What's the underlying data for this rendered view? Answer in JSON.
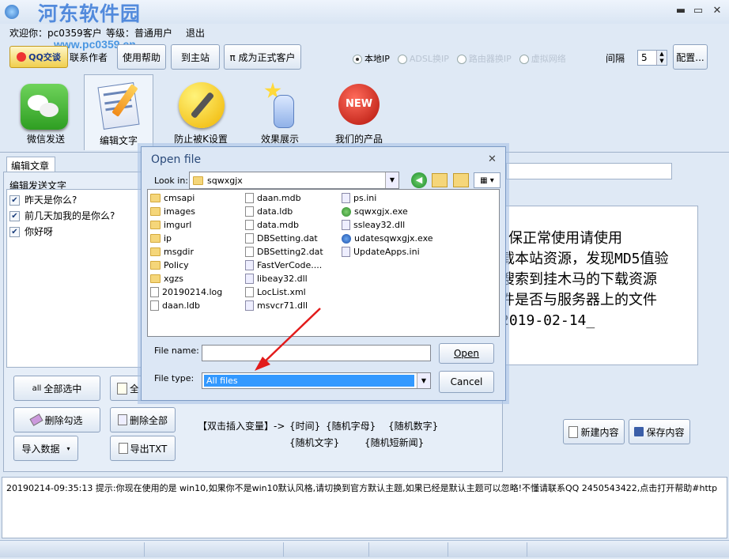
{
  "app": {
    "title_watermark": "河东软件园",
    "url_watermark": "www.pc0359.cn",
    "welcome": "欢迎你：pc0359客户",
    "level": "等级：普通用户",
    "logout": "退出"
  },
  "toolbar": {
    "qq": "QQ交谈",
    "contact": "联系作者",
    "help": "使用帮助",
    "site": "到主站",
    "upgrade": "π 成为正式客户",
    "radios": [
      {
        "label": "本地IP",
        "selected": true
      },
      {
        "label": "ADSL换IP",
        "selected": false
      },
      {
        "label": "路由器换IP",
        "selected": false
      },
      {
        "label": "虚拟网络",
        "selected": false
      }
    ],
    "interval_label": "间隔",
    "interval_value": "5",
    "config": "配置..."
  },
  "tabs": [
    {
      "label": "微信发送",
      "icon": "wechat-icon"
    },
    {
      "label": "编辑文字",
      "icon": "edit-icon"
    },
    {
      "label": "防止被K设置",
      "icon": "wrench-icon"
    },
    {
      "label": "效果展示",
      "icon": "pointer-icon"
    },
    {
      "label": "我们的产品",
      "icon": "new-badge-icon"
    }
  ],
  "editor": {
    "subtab": "编辑文章",
    "group": "编辑发送文字",
    "items": [
      "昨天是你么?",
      "前几天加我的是你么?",
      "你好呀"
    ],
    "right_text": [
      "保正常使用请使用",
      "",
      "载本站资源，发现MD5值验",
      "搜索到挂木马的下载资源",
      "件是否与服务器上的文件",
      "2019-02-14_"
    ]
  },
  "actions": {
    "select_all": "全部选中",
    "select_all2": "全",
    "delete_checked": "删除勾选",
    "delete_all": "删除全部",
    "import": "导入数据",
    "export": "导出TXT",
    "insert_label": "【双击插入变量】->",
    "vars_row1": [
      "{时间}",
      "{随机字母}",
      "{随机数字}"
    ],
    "vars_row2": [
      "{随机文字}",
      "{随机短新闻}"
    ],
    "new_content": "新建内容",
    "save_content": "保存内容"
  },
  "log": "20190214-09:35:13  提示:你现在使用的是 win10,如果你不是win10默认风格,请切换到官方默认主题,如果已经是默认主题可以忽略!不懂请联系QQ 2450543422,点击打开帮助#http",
  "dialog": {
    "title": "Open file",
    "look_in_label": "Look in:",
    "look_in_value": "sqwxgjx",
    "col1": [
      {
        "name": "cmsapi",
        "type": "folder"
      },
      {
        "name": "images",
        "type": "folder"
      },
      {
        "name": "imgurl",
        "type": "folder"
      },
      {
        "name": "ip",
        "type": "folder"
      },
      {
        "name": "msgdir",
        "type": "folder"
      },
      {
        "name": "Policy",
        "type": "folder"
      },
      {
        "name": "xgzs",
        "type": "folder"
      },
      {
        "name": "20190214.log",
        "type": "file"
      },
      {
        "name": "daan.ldb",
        "type": "file"
      }
    ],
    "col2": [
      {
        "name": "daan.mdb",
        "type": "file"
      },
      {
        "name": "data.ldb",
        "type": "file"
      },
      {
        "name": "data.mdb",
        "type": "file"
      },
      {
        "name": "DBSetting.dat",
        "type": "file"
      },
      {
        "name": "DBSetting2.dat",
        "type": "file"
      },
      {
        "name": "FastVerCode....",
        "type": "dll"
      },
      {
        "name": "libeay32.dll",
        "type": "dll"
      },
      {
        "name": "LocList.xml",
        "type": "file"
      },
      {
        "name": "msvcr71.dll",
        "type": "dll"
      }
    ],
    "col3": [
      {
        "name": "ps.ini",
        "type": "dll"
      },
      {
        "name": "sqwxgjx.exe",
        "type": "exe"
      },
      {
        "name": "ssleay32.dll",
        "type": "dll"
      },
      {
        "name": "udatesqwxgjx.exe",
        "type": "exe2"
      },
      {
        "name": "UpdateApps.ini",
        "type": "dll"
      }
    ],
    "filename_label": "File name:",
    "filename_value": "",
    "filetype_label": "File type:",
    "filetype_value": "All files",
    "open": "Open",
    "cancel": "Cancel"
  }
}
